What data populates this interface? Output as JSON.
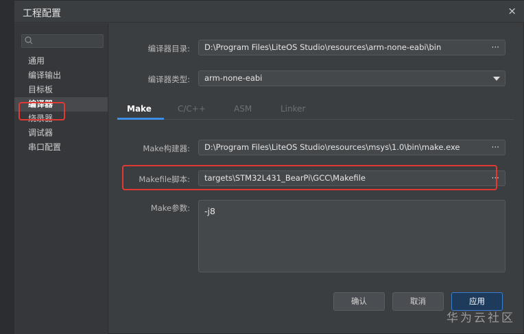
{
  "window": {
    "title": "工程配置",
    "close_glyph": "×"
  },
  "sidebar": {
    "search_placeholder": "",
    "items": [
      {
        "label": "通用"
      },
      {
        "label": "编译输出"
      },
      {
        "label": "目标板"
      },
      {
        "label": "编译器",
        "active": true
      },
      {
        "label": "烧录器"
      },
      {
        "label": "调试器"
      },
      {
        "label": "串口配置"
      }
    ]
  },
  "compiler": {
    "dir_label": "编译器目录:",
    "dir_value": "D:\\Program Files\\LiteOS Studio\\resources\\arm-none-eabi\\bin",
    "type_label": "编译器类型:",
    "type_value": "arm-none-eabi"
  },
  "tabs": [
    {
      "label": "Make",
      "active": true
    },
    {
      "label": "C/C++"
    },
    {
      "label": "ASM"
    },
    {
      "label": "Linker"
    }
  ],
  "make": {
    "builder_label": "Make构建器:",
    "builder_value": "D:\\Program Files\\LiteOS Studio\\resources\\msys\\1.0\\bin\\make.exe",
    "makefile_label": "Makefile脚本:",
    "makefile_value": "targets\\STM32L431_BearPi\\GCC\\Makefile",
    "params_label": "Make参数:",
    "params_value": "-j8"
  },
  "ellipsis": "···",
  "buttons": {
    "confirm": "确认",
    "cancel": "取消",
    "apply": "应用"
  },
  "watermark": "华为云社区",
  "colors": {
    "accent": "#3e8ee8",
    "highlight": "#e23a32"
  }
}
